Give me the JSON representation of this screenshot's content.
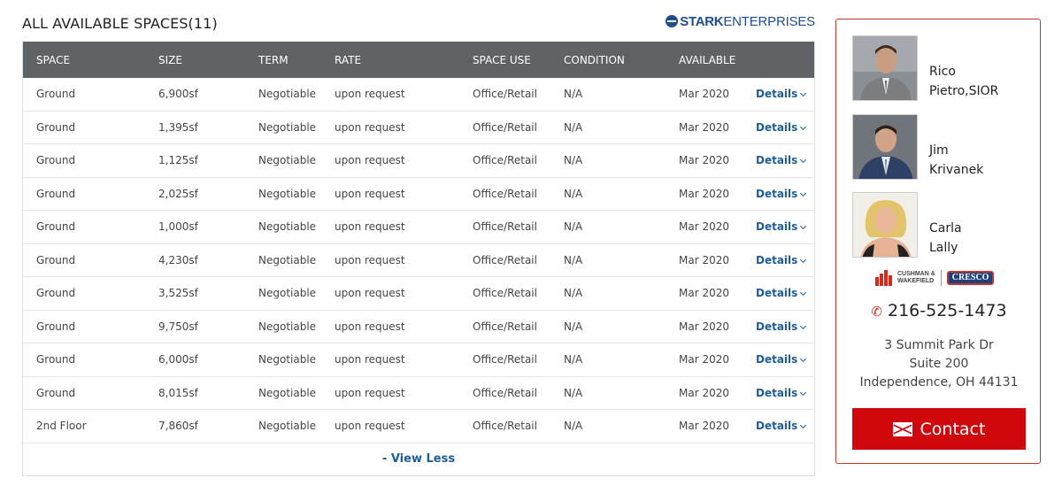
{
  "page": {
    "title": "ALL AVAILABLE SPACES(11)",
    "brand": {
      "strong": "STARK",
      "light": "ENTERPRISES"
    }
  },
  "table": {
    "headers": [
      "SPACE",
      "SIZE",
      "TERM",
      "RATE",
      "SPACE USE",
      "CONDITION",
      "AVAILABLE"
    ],
    "rows": [
      {
        "space": "Ground",
        "size": "6,900sf",
        "term": "Negotiable",
        "rate": "upon request",
        "use": "Office/Retail",
        "condition": "N/A",
        "available": "Mar 2020",
        "details": "Details"
      },
      {
        "space": "Ground",
        "size": "1,395sf",
        "term": "Negotiable",
        "rate": "upon request",
        "use": "Office/Retail",
        "condition": "N/A",
        "available": "Mar 2020",
        "details": "Details"
      },
      {
        "space": "Ground",
        "size": "1,125sf",
        "term": "Negotiable",
        "rate": "upon request",
        "use": "Office/Retail",
        "condition": "N/A",
        "available": "Mar 2020",
        "details": "Details"
      },
      {
        "space": "Ground",
        "size": "2,025sf",
        "term": "Negotiable",
        "rate": "upon request",
        "use": "Office/Retail",
        "condition": "N/A",
        "available": "Mar 2020",
        "details": "Details"
      },
      {
        "space": "Ground",
        "size": "1,000sf",
        "term": "Negotiable",
        "rate": "upon request",
        "use": "Office/Retail",
        "condition": "N/A",
        "available": "Mar 2020",
        "details": "Details"
      },
      {
        "space": "Ground",
        "size": "4,230sf",
        "term": "Negotiable",
        "rate": "upon request",
        "use": "Office/Retail",
        "condition": "N/A",
        "available": "Mar 2020",
        "details": "Details"
      },
      {
        "space": "Ground",
        "size": "3,525sf",
        "term": "Negotiable",
        "rate": "upon request",
        "use": "Office/Retail",
        "condition": "N/A",
        "available": "Mar 2020",
        "details": "Details"
      },
      {
        "space": "Ground",
        "size": "9,750sf",
        "term": "Negotiable",
        "rate": "upon request",
        "use": "Office/Retail",
        "condition": "N/A",
        "available": "Mar 2020",
        "details": "Details"
      },
      {
        "space": "Ground",
        "size": "6,000sf",
        "term": "Negotiable",
        "rate": "upon request",
        "use": "Office/Retail",
        "condition": "N/A",
        "available": "Mar 2020",
        "details": "Details"
      },
      {
        "space": "Ground",
        "size": "8,015sf",
        "term": "Negotiable",
        "rate": "upon request",
        "use": "Office/Retail",
        "condition": "N/A",
        "available": "Mar 2020",
        "details": "Details"
      },
      {
        "space": "2nd Floor",
        "size": "7,860sf",
        "term": "Negotiable",
        "rate": "upon request",
        "use": "Office/Retail",
        "condition": "N/A",
        "available": "Mar 2020",
        "details": "Details"
      }
    ],
    "view_less": "- View Less"
  },
  "sidebar": {
    "agents": [
      {
        "first": "Rico",
        "last": "Pietro,SIOR"
      },
      {
        "first": "Jim",
        "last": "Krivanek"
      },
      {
        "first": "Carla",
        "last": "Lally"
      }
    ],
    "logos": {
      "cw": "CUSHMAN &",
      "cw2": "WAKEFIELD",
      "cresco": "CRESCO"
    },
    "phone": "216-525-1473",
    "address": [
      "3 Summit Park Dr",
      "Suite 200",
      "Independence, OH 44131"
    ],
    "contact_label": "Contact"
  },
  "colors": {
    "header_bg": "#606366",
    "link": "#1f5d99",
    "accent_red": "#d0080e",
    "brand_blue": "#1f4e8c"
  }
}
